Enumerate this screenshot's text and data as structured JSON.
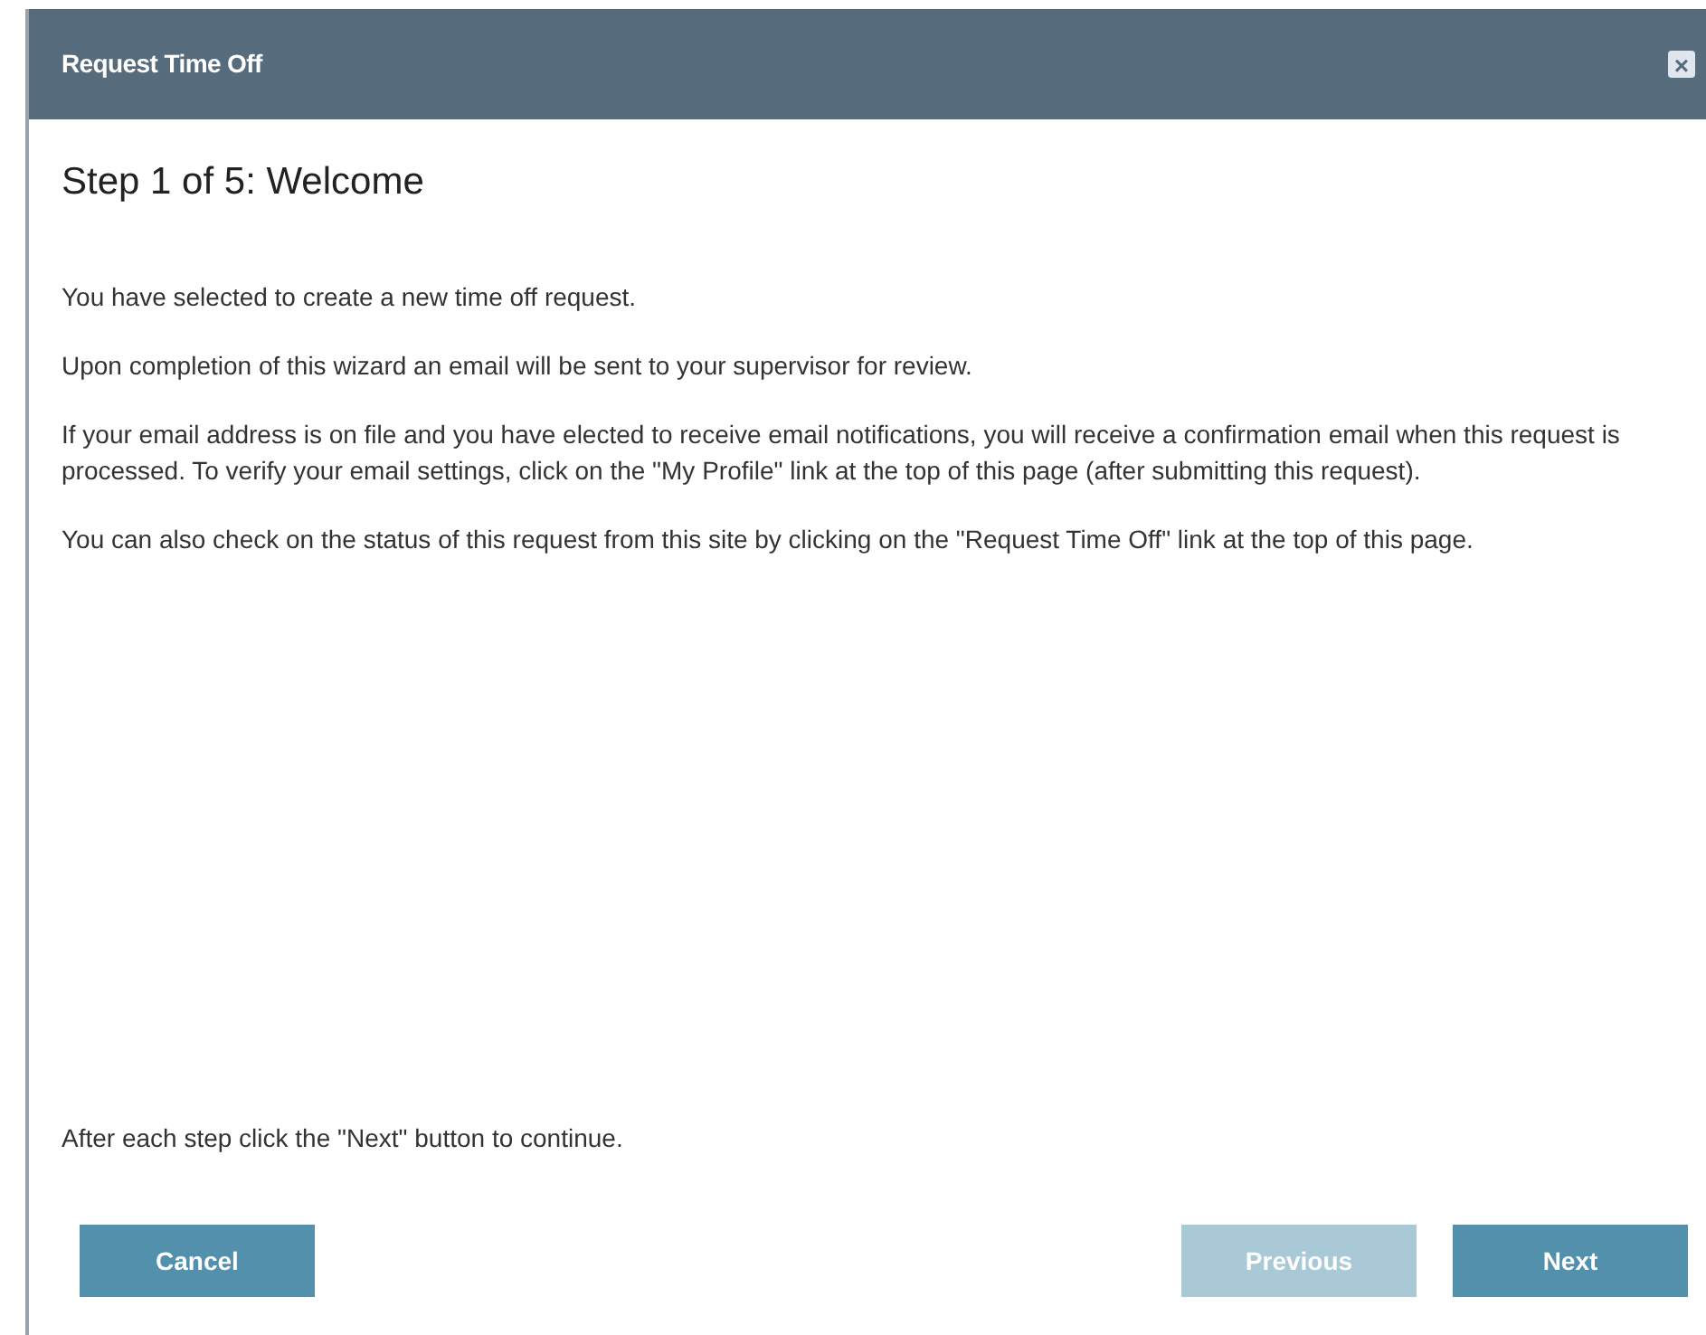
{
  "dialog": {
    "title": "Request Time Off",
    "close": "×"
  },
  "step_title": "Step 1 of 5: Welcome",
  "paragraphs": [
    "You have selected to create a new time off request.",
    "Upon completion of this wizard an email will be sent to your supervisor for review.",
    "If your email address is on file and you have elected to receive email notifications, you will receive a confirmation email when this request is processed. To verify your email settings, click on the \"My Profile\" link at the top of this page (after submitting this request).",
    "You can also check on the status of this request from this site by clicking on the \"Request Time Off\" link at the top of this page."
  ],
  "footer_note": "After each step click the \"Next\" button to continue.",
  "buttons": [
    {
      "label": "Cancel",
      "disabled": false
    },
    {
      "label": "Previous",
      "disabled": true
    },
    {
      "label": "Next",
      "disabled": false
    }
  ]
}
